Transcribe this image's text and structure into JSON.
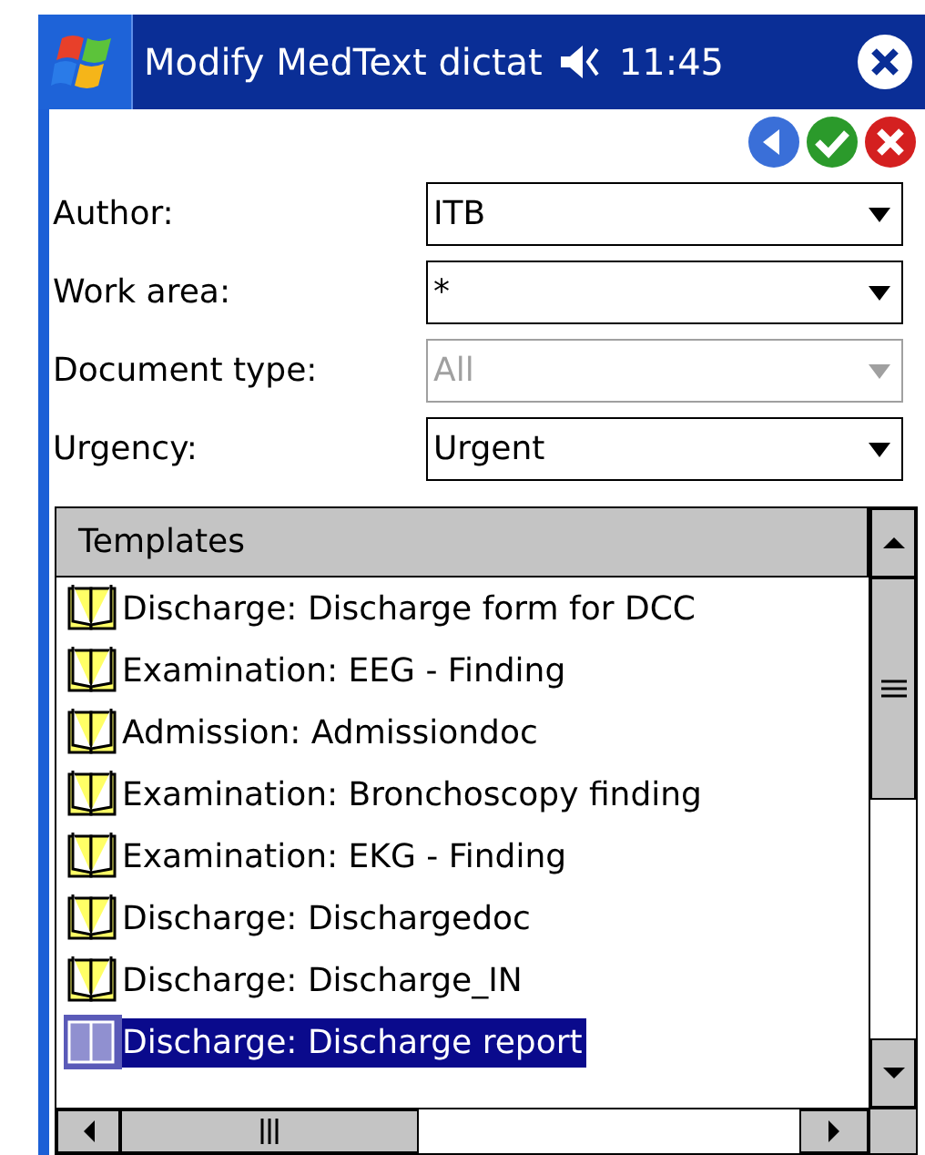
{
  "title_bar": {
    "title": "Modify MedText dictat",
    "time": "11:45"
  },
  "fields": [
    {
      "label": "Author:",
      "value": "ITB",
      "disabled": false
    },
    {
      "label": "Work area:",
      "value": "*",
      "disabled": false
    },
    {
      "label": "Document type:",
      "value": "All",
      "disabled": true
    },
    {
      "label": "Urgency:",
      "value": "Urgent",
      "disabled": false
    }
  ],
  "templates": {
    "header": "Templates",
    "items": [
      {
        "label": "Discharge: Discharge form for DCC",
        "selected": false
      },
      {
        "label": "Examination: EEG - Finding",
        "selected": false
      },
      {
        "label": "Admission: Admissiondoc",
        "selected": false
      },
      {
        "label": "Examination: Bronchoscopy finding",
        "selected": false
      },
      {
        "label": "Examination: EKG - Finding",
        "selected": false
      },
      {
        "label": "Discharge: Dischargedoc",
        "selected": false
      },
      {
        "label": "Discharge: Discharge_IN",
        "selected": false
      },
      {
        "label": "Discharge: Discharge report",
        "selected": true
      }
    ]
  }
}
